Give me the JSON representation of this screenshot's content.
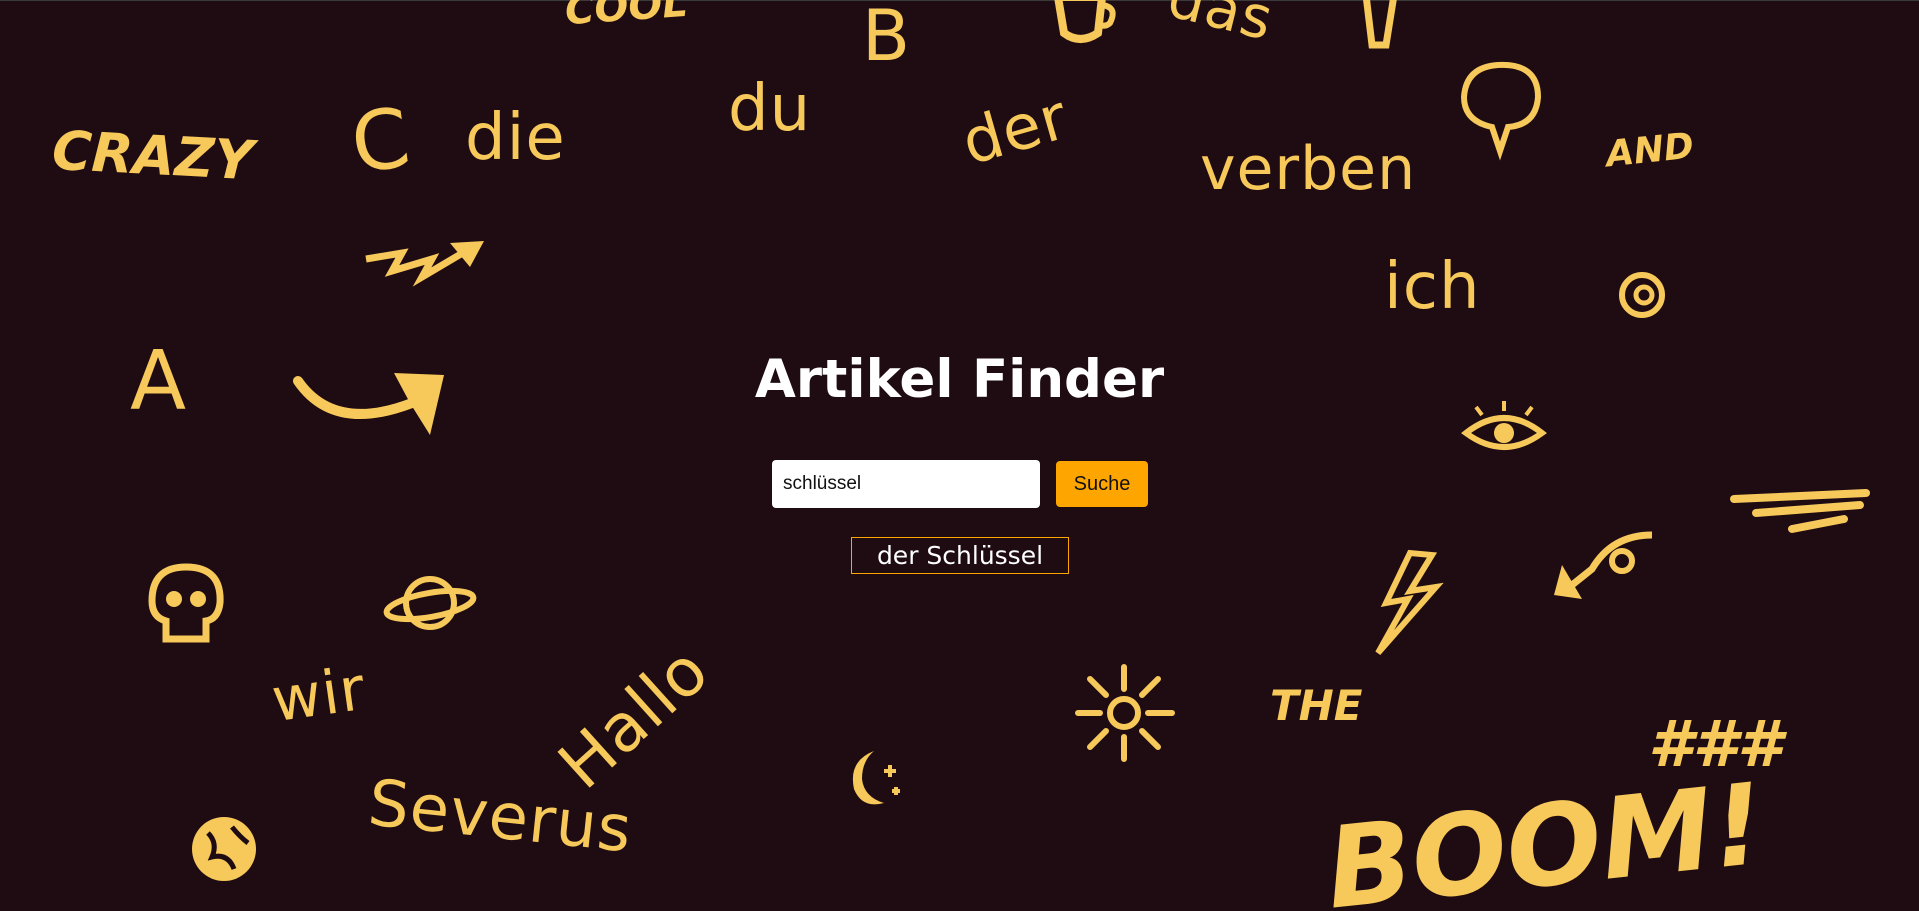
{
  "app": {
    "title": "Artikel Finder"
  },
  "search": {
    "value": "schlüssel",
    "button_label": "Suche"
  },
  "result": {
    "text": "der Schlüssel"
  },
  "background": {
    "doodle_color": "#f7c85a",
    "bg_color": "#1e0c12",
    "accent": "#ffa500",
    "words": {
      "cool": "COOL",
      "b": "B",
      "das": "das",
      "crazy": "CRAZY",
      "c": "C",
      "die": "die",
      "du": "du",
      "der": "der",
      "verben": "verben",
      "and": "AND",
      "ich": "ich",
      "a": "A",
      "wir": "wir",
      "hallo": "Hallo",
      "the": "THE",
      "severus": "Severus",
      "boom": "BOOM!",
      "hash": "###"
    },
    "icons": [
      "cup-icon",
      "speech-bubble-icon",
      "zigzag-arrow-icon",
      "curved-arrow-icon",
      "at-sign-icon",
      "eye-icon",
      "skull-icon",
      "planet-icon",
      "lightning-icon",
      "spiral-arrow-icon",
      "dash-lines-icon",
      "sun-icon",
      "moon-stars-icon",
      "globe-icon",
      "exclamation-icon"
    ]
  }
}
